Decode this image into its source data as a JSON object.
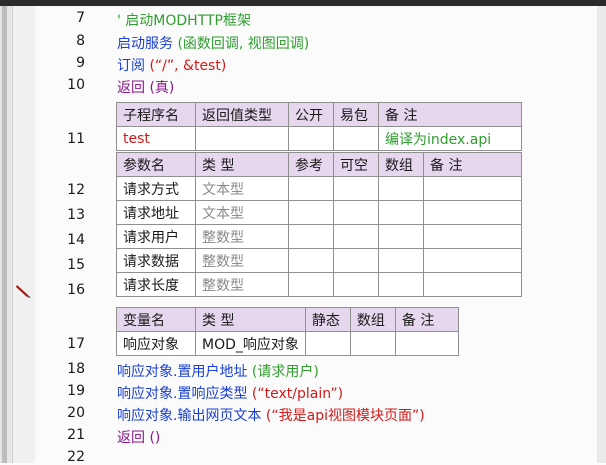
{
  "line_numbers": [
    "7",
    "8",
    "9",
    "10",
    "11",
    "12",
    "13",
    "14",
    "15",
    "16",
    "17",
    "18",
    "19",
    "20",
    "21",
    "22"
  ],
  "code": {
    "line7": "' 启动MODHTTP框架",
    "line8_cmd": "启动服务",
    "line8_args": " (函数回调, 视图回调)",
    "line9_cmd": "订阅",
    "line9_args": " (“/”, &test)",
    "line10_cmd": "返回",
    "line10_args": " (真)",
    "line18_obj": "响应对象",
    "line18_method": ".置用户地址",
    "line18_args": " (请求用户)",
    "line19_obj": "响应对象",
    "line19_method": ".置响应类型",
    "line19_args": " (“text/plain”)",
    "line20_obj": "响应对象",
    "line20_method": ".输出网页文本",
    "line20_args": " (“我是api视图模块页面”)",
    "line21_cmd": "返回",
    "line21_args": " ()"
  },
  "sub_table": {
    "headers": [
      "子程序名",
      "返回值类型",
      "公开",
      "易包",
      "备 注"
    ],
    "name": "test",
    "return_type": "",
    "public": "",
    "easy_pack": "",
    "remark": "编译为index.api"
  },
  "param_table": {
    "headers": [
      "参数名",
      "类 型",
      "参考",
      "可空",
      "数组",
      "备 注"
    ],
    "rows": [
      {
        "name": "请求方式",
        "type": "文本型"
      },
      {
        "name": "请求地址",
        "type": "文本型"
      },
      {
        "name": "请求用户",
        "type": "整数型"
      },
      {
        "name": "请求数据",
        "type": "整数型"
      },
      {
        "name": "请求长度",
        "type": "整数型"
      }
    ]
  },
  "var_table": {
    "headers": [
      "变量名",
      "类 型",
      "静态",
      "数组",
      "备 注"
    ],
    "rows": [
      {
        "name": "响应对象",
        "type": "MOD_响应对象"
      }
    ]
  },
  "colors": {
    "header_bg": "#e6d6ee",
    "comment": "#2f9e2f",
    "keyword": "#1a3fd6",
    "flow": "#8a1a8a",
    "sub_name": "#d21a1a"
  },
  "icons": [
    "pencil-icon"
  ]
}
